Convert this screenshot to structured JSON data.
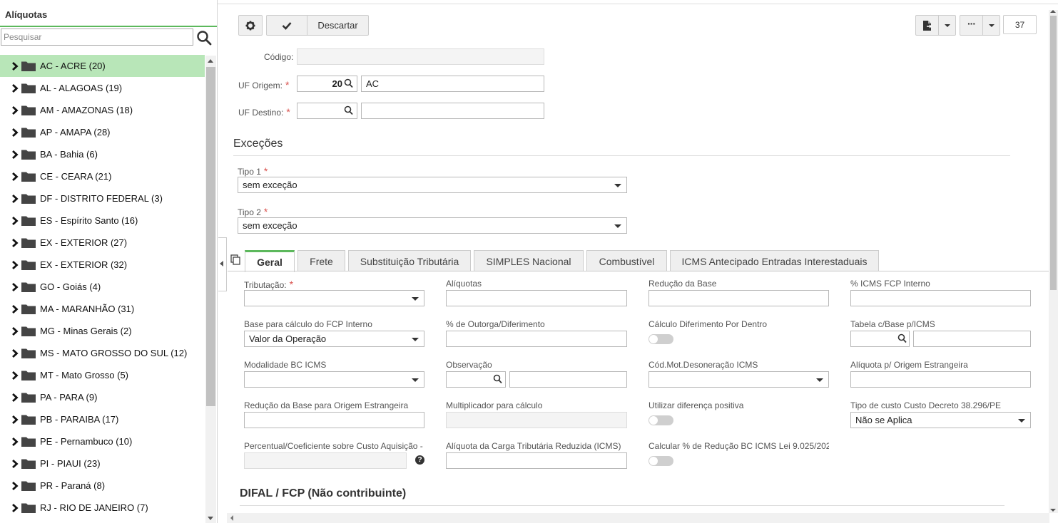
{
  "sidebar": {
    "title": "Alíquotas",
    "search_placeholder": "Pesquisar",
    "items": [
      {
        "label": "AC - ACRE (20)"
      },
      {
        "label": "AL - ALAGOAS (19)"
      },
      {
        "label": "AM - AMAZONAS (18)"
      },
      {
        "label": "AP - AMAPA (28)"
      },
      {
        "label": "BA - Bahia (6)"
      },
      {
        "label": "CE - CEARA (21)"
      },
      {
        "label": "DF - DISTRITO FEDERAL (3)"
      },
      {
        "label": "ES - Espírito Santo (16)"
      },
      {
        "label": "EX - EXTERIOR (27)"
      },
      {
        "label": "EX - EXTERIOR (32)"
      },
      {
        "label": "GO - Goiás (4)"
      },
      {
        "label": "MA - MARANHÃO (31)"
      },
      {
        "label": "MG - Minas Gerais (2)"
      },
      {
        "label": "MS - MATO GROSSO DO SUL (12)"
      },
      {
        "label": "MT - Mato Grosso (5)"
      },
      {
        "label": "PA - PARA (9)"
      },
      {
        "label": "PB - PARAIBA (17)"
      },
      {
        "label": "PE - Pernambuco (10)"
      },
      {
        "label": "PI - PIAUI (23)"
      },
      {
        "label": "PR - Paraná (8)"
      },
      {
        "label": "RJ - RIO DE JANEIRO (7)"
      }
    ],
    "selected_index": 0
  },
  "toolbar": {
    "discard_label": "Descartar",
    "record_count": "37"
  },
  "form": {
    "codigo_label": "Código:",
    "codigo_value": "",
    "uf_origem_label": "UF Origem:",
    "uf_origem_code": "20",
    "uf_origem_name": "AC",
    "uf_destino_label": "UF Destino:",
    "uf_destino_code": "",
    "uf_destino_name": "",
    "required_mark": "*"
  },
  "excecoes": {
    "title": "Exceções",
    "tipo1_label": "Tipo 1",
    "tipo1_value": "sem exceção",
    "tipo2_label": "Tipo 2",
    "tipo2_value": "sem exceção"
  },
  "tabs": [
    {
      "label": "Geral",
      "active": true
    },
    {
      "label": "Frete"
    },
    {
      "label": "Substituição Tributária"
    },
    {
      "label": "SIMPLES Nacional"
    },
    {
      "label": "Combustível"
    },
    {
      "label": "ICMS Antecipado Entradas Interestaduais"
    }
  ],
  "geral": {
    "tributacao_label": "Tributação:",
    "aliquotas_label": "Alíquotas",
    "reducao_base_label": "Redução da Base",
    "icms_fcp_label": "% ICMS FCP Interno",
    "base_fcp_label": "Base para cálculo do FCP Interno",
    "base_fcp_value": "Valor da Operação",
    "outorga_label": "% de Outorga/Diferimento",
    "calc_diferimento_label": "Cálculo Diferimento Por Dentro",
    "tabela_base_label": "Tabela c/Base p/ICMS",
    "modalidade_label": "Modalidade BC ICMS",
    "observacao_label": "Observação",
    "cod_mot_label": "Cód.Mot.Desoneração ICMS",
    "aliq_origem_estrangeira_label": "Alíquota p/ Origem Estrangeira",
    "reducao_origem_label": "Redução da Base para Origem Estrangeira",
    "multiplicador_label": "Multiplicador para cálculo",
    "utilizar_diferenca_label": "Utilizar diferença positiva",
    "tipo_custo_label": "Tipo de custo Custo Decreto 38.296/PE",
    "tipo_custo_value": "Não se Aplica",
    "percentual_label": "Percentual/Coeficiente sobre Custo Aquisição -",
    "aliq_carga_label": "Alíquota da Carga Tributária Reduzida (ICMS)",
    "calcular_reducao_label": "Calcular % de Redução BC ICMS Lei 9.025/202"
  },
  "difal": {
    "title": "DIFAL / FCP (Não contribuinte)"
  }
}
